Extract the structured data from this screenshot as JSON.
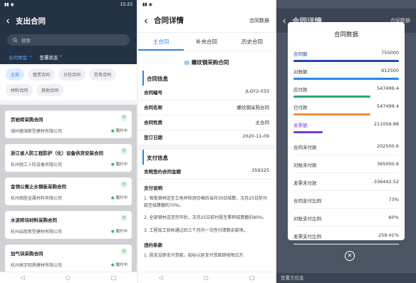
{
  "s1": {
    "status_time": "15:23",
    "title": "支出合同",
    "search_placeholder": "搜索",
    "filter_type": "合同类型 ^",
    "filter_status": "签署状态 ˅",
    "chips": [
      "全部",
      "租赁合同",
      "分包合同",
      "劳务合同",
      "材料合同",
      "其他合同"
    ],
    "cards": [
      {
        "title": "页岩砖采购合同",
        "company": "湖州德海新型建材有限公司",
        "status": "履约中",
        "tag": "材"
      },
      {
        "title": "浙江省人防工程防护（化）设备供货安装合同",
        "company": "杭州锐工人防设备有限公司",
        "status": "履约中",
        "tag": "材"
      },
      {
        "title": "金领公寓止水钢板采购合同",
        "company": "杭州南胜金属材料有限公司",
        "status": "履约中",
        "tag": "材"
      },
      {
        "title": "水泥砖块材料采购合同",
        "company": "杭州启航新型建材有限公司",
        "status": "履约中",
        "tag": "材"
      },
      {
        "title": "加气块采购合同",
        "company": "杭州高宇轻质建材有限公司",
        "status": "履约中",
        "tag": "材"
      }
    ]
  },
  "s2": {
    "title": "合同详情",
    "right": "合同数据",
    "tabs": [
      "主合同",
      "补充合同",
      "历史合同"
    ],
    "contract_title": "螺纹钢采购合同",
    "sec_info": "合同信息",
    "fields": [
      {
        "k": "合同编号",
        "v": "JLGY2-033"
      },
      {
        "k": "合同名称",
        "v": "螺纹钢采购合同"
      },
      {
        "k": "合同性质",
        "v": "主合同"
      },
      {
        "k": "签订日期",
        "v": "2020-11-09"
      }
    ],
    "sec_pay": "支付信息",
    "amount_k": "含税签约合同金额",
    "amount_v": "359325",
    "pay_desc": "支付说明",
    "p1": "1. 每批钢材送至工地并检测合格后当月30日结算，次月25日前付款至结算额的70%。",
    "p2": "2. 全部钢材送货完毕后，次月25日前付款至累积结算额的80%。",
    "p3": "3. 工程竣工验收通过后三个月内一次性付清剩余款项。",
    "breach": "违约条款",
    "p4": "1. 因支设即支付货款，招标以延支付货款即按每日万"
  },
  "s3": {
    "bg_title": "合同详情",
    "bg_right": "合同数据",
    "modal_title": "合同数据",
    "rows": [
      {
        "k": "合同额",
        "v": "750000",
        "color": "#1f4aa8",
        "pct": 1.0
      },
      {
        "k": "对账额",
        "v": "912500",
        "color": "#2a86e8",
        "pct": 1.0
      },
      {
        "k": "应付款",
        "v": "547499.4",
        "color": "#25a86e",
        "pct": 0.73
      },
      {
        "k": "已付款",
        "v": "547499.4",
        "color": "#f08c3a",
        "pct": 0.73
      },
      {
        "k": "发票额",
        "v": "211056.88",
        "color": "#7a3bd4",
        "pct": 0.28
      }
    ],
    "stats": [
      {
        "k": "合同未付款",
        "v": "202500.6"
      },
      {
        "k": "对账未付款",
        "v": "365000.6"
      },
      {
        "k": "发票未付款",
        "v": "-336442.52"
      },
      {
        "k": "合同支付比例",
        "v": "73%"
      },
      {
        "k": "对账支付比例",
        "v": "60%"
      },
      {
        "k": "发票支付比例",
        "v": "259.41%"
      }
    ],
    "close": "✕",
    "foot": "签署方信息"
  }
}
